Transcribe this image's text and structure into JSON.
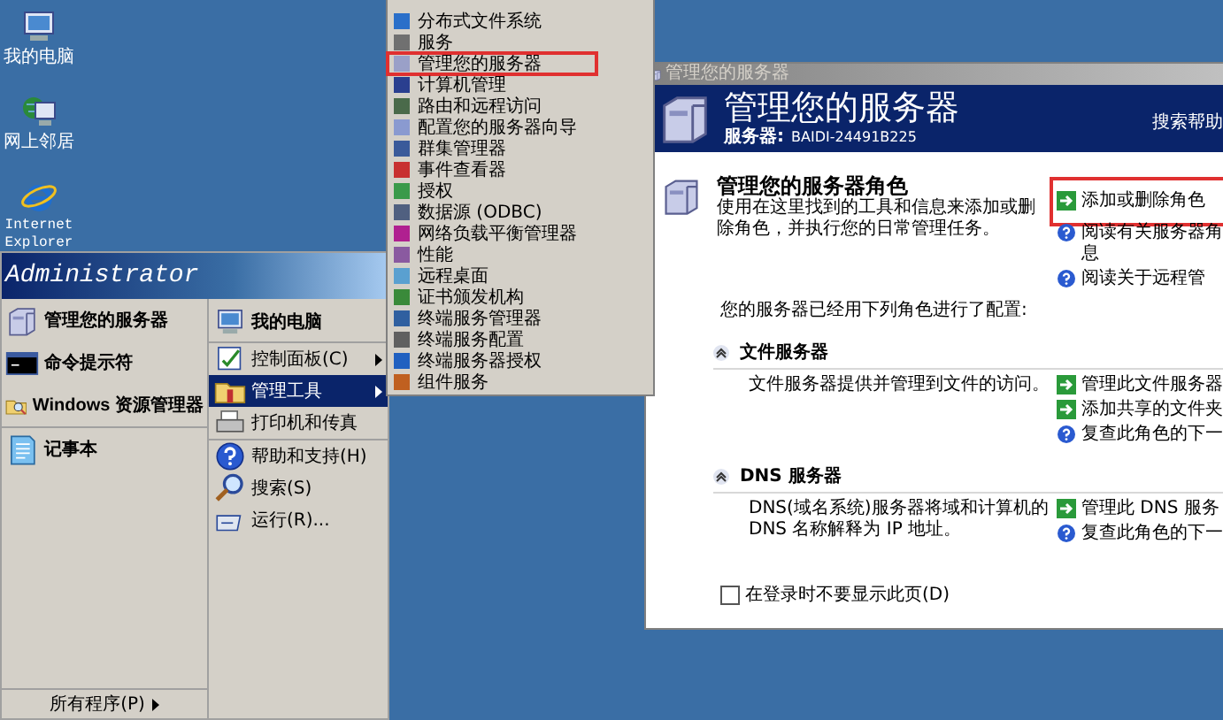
{
  "desktop_icons": [
    {
      "label": "我的电脑",
      "kind": "computer"
    },
    {
      "label": "网上邻居",
      "kind": "network"
    },
    {
      "label": "Internet Explorer",
      "kind": "browser"
    }
  ],
  "start_menu": {
    "user": "Administrator",
    "pinned": [
      [
        {
          "label": "管理您的服务器",
          "kind": "server"
        },
        {
          "label": "命令提示符",
          "kind": "console"
        },
        {
          "label": "Windows 资源管理器",
          "kind": "explorer"
        }
      ],
      [
        {
          "label": "记事本",
          "kind": "notepad"
        }
      ]
    ],
    "places": [
      [
        {
          "label": "我的电脑",
          "kind": "computer",
          "bold": true,
          "submenu": false,
          "selected": false
        }
      ],
      [
        {
          "label": "控制面板(C)",
          "kind": "control",
          "bold": false,
          "submenu": true,
          "selected": false
        },
        {
          "label": "管理工具",
          "kind": "tools",
          "bold": false,
          "submenu": true,
          "selected": true
        },
        {
          "label": "打印机和传真",
          "kind": "printer",
          "bold": false,
          "submenu": false,
          "selected": false
        }
      ],
      [
        {
          "label": "帮助和支持(H)",
          "kind": "help",
          "bold": false,
          "submenu": false,
          "selected": false
        },
        {
          "label": "搜索(S)",
          "kind": "search",
          "bold": false,
          "submenu": false,
          "selected": false
        },
        {
          "label": "运行(R)...",
          "kind": "run",
          "bold": false,
          "submenu": false,
          "selected": false
        }
      ]
    ],
    "all_programs": "所有程序(P)"
  },
  "admin_tools_menu": [
    {
      "label": "分布式文件系统",
      "highlighted": false,
      "color": "#2a6fc9"
    },
    {
      "label": "服务",
      "highlighted": false,
      "color": "#707070"
    },
    {
      "label": "管理您的服务器",
      "highlighted": true,
      "color": "#9aa0c8"
    },
    {
      "label": "计算机管理",
      "highlighted": false,
      "color": "#2a3f8f"
    },
    {
      "label": "路由和远程访问",
      "highlighted": false,
      "color": "#4a6a4a"
    },
    {
      "label": "配置您的服务器向导",
      "highlighted": false,
      "color": "#8a9ad0"
    },
    {
      "label": "群集管理器",
      "highlighted": false,
      "color": "#3a5a9a"
    },
    {
      "label": "事件查看器",
      "highlighted": false,
      "color": "#c83030"
    },
    {
      "label": "授权",
      "highlighted": false,
      "color": "#3a9a4a"
    },
    {
      "label": "数据源 (ODBC)",
      "highlighted": false,
      "color": "#506080"
    },
    {
      "label": "网络负载平衡管理器",
      "highlighted": false,
      "color": "#b02090"
    },
    {
      "label": "性能",
      "highlighted": false,
      "color": "#8a5aa0"
    },
    {
      "label": "远程桌面",
      "highlighted": false,
      "color": "#5aa0d0"
    },
    {
      "label": "证书颁发机构",
      "highlighted": false,
      "color": "#3a8a3a"
    },
    {
      "label": "终端服务管理器",
      "highlighted": false,
      "color": "#3060a0"
    },
    {
      "label": "终端服务配置",
      "highlighted": false,
      "color": "#606060"
    },
    {
      "label": "终端服务器授权",
      "highlighted": false,
      "color": "#2060c0"
    },
    {
      "label": "组件服务",
      "highlighted": false,
      "color": "#c06020"
    }
  ],
  "window": {
    "title": "管理您的服务器",
    "heading": "管理您的服务器",
    "server_label": "服务器:",
    "server_name": "BAIDI-24491B225",
    "search_help": "搜索帮助",
    "intro": {
      "title": "管理您的服务器角色",
      "text": "使用在这里找到的工具和信息来添加或删除角色，并执行您的日常管理任务。",
      "links": [
        {
          "lines": [
            "添加或删除角色"
          ],
          "kind": "action",
          "highlighted": true
        },
        {
          "lines": [
            "阅读有关服务器角",
            "息"
          ],
          "kind": "help",
          "highlighted": false
        },
        {
          "lines": [
            "阅读关于远程管"
          ],
          "kind": "help",
          "highlighted": false
        }
      ]
    },
    "configured_text": "您的服务器已经用下列角色进行了配置:",
    "roles": [
      {
        "name": "文件服务器",
        "expanded": true,
        "text": "文件服务器提供并管理到文件的访问。",
        "links": [
          {
            "lines": [
              "管理此文件服务器"
            ],
            "kind": "action",
            "highlighted": false
          },
          {
            "lines": [
              "添加共享的文件夹"
            ],
            "kind": "action",
            "highlighted": false
          },
          {
            "lines": [
              "复查此角色的下一"
            ],
            "kind": "help",
            "highlighted": false
          }
        ]
      },
      {
        "name": "DNS 服务器",
        "expanded": true,
        "text": "DNS(域名系统)服务器将域和计算机的 DNS 名称解释为 IP 地址。",
        "links": [
          {
            "lines": [
              "管理此 DNS 服务"
            ],
            "kind": "action",
            "highlighted": false
          },
          {
            "lines": [
              "复查此角色的下一"
            ],
            "kind": "help",
            "highlighted": false
          }
        ]
      }
    ],
    "dont_show": {
      "label": "在登录时不要显示此页(D)",
      "checked": false
    }
  }
}
